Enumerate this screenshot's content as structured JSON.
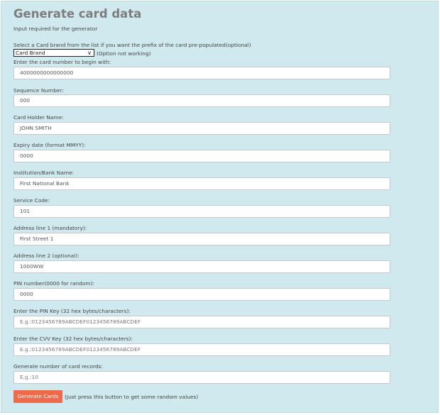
{
  "header": {
    "title": "Generate card data",
    "subtitle": "Input required for the generator"
  },
  "brand": {
    "label": "Select a Card brand from the list if you want the prefix of the card pre-populated(optional)",
    "selected": "Card Brand",
    "note": "(Option not working)"
  },
  "fields": [
    {
      "label": "Enter the card number to begin with:",
      "value": "4000000000000000"
    },
    {
      "label": "Sequence Number:",
      "value": "000"
    },
    {
      "label": "Card Holder Name:",
      "value": "JOHN SMITH"
    },
    {
      "label": "Expiry date (format MMYY):",
      "value": "0000"
    },
    {
      "label": "Institution/Bank Name:",
      "value": "First National Bank"
    },
    {
      "label": "Service Code:",
      "value": "101"
    },
    {
      "label": "Address line 1 (mandatory):",
      "value": "First Street 1"
    },
    {
      "label": "Address line 2 (optional):",
      "value": "1000WW"
    },
    {
      "label": "PIN number(0000 for random):",
      "value": "0000"
    },
    {
      "label": "Enter the PIN Key (32 hex bytes/characters):",
      "value": "",
      "placeholder": "E.g.:0123456789ABCDEF0123456789ABCDEF"
    },
    {
      "label": "Enter the CVV Key (32 hex bytes/characters):",
      "value": "",
      "placeholder": "E.g.:0123456789ABCDEF0123456789ABCDEF"
    },
    {
      "label": "Generate number of card records:",
      "value": "",
      "placeholder": "E.g.:10"
    }
  ],
  "actions": {
    "generate_label": "Generate Cards",
    "generate_note": "(Just press this button to get some random values)"
  }
}
